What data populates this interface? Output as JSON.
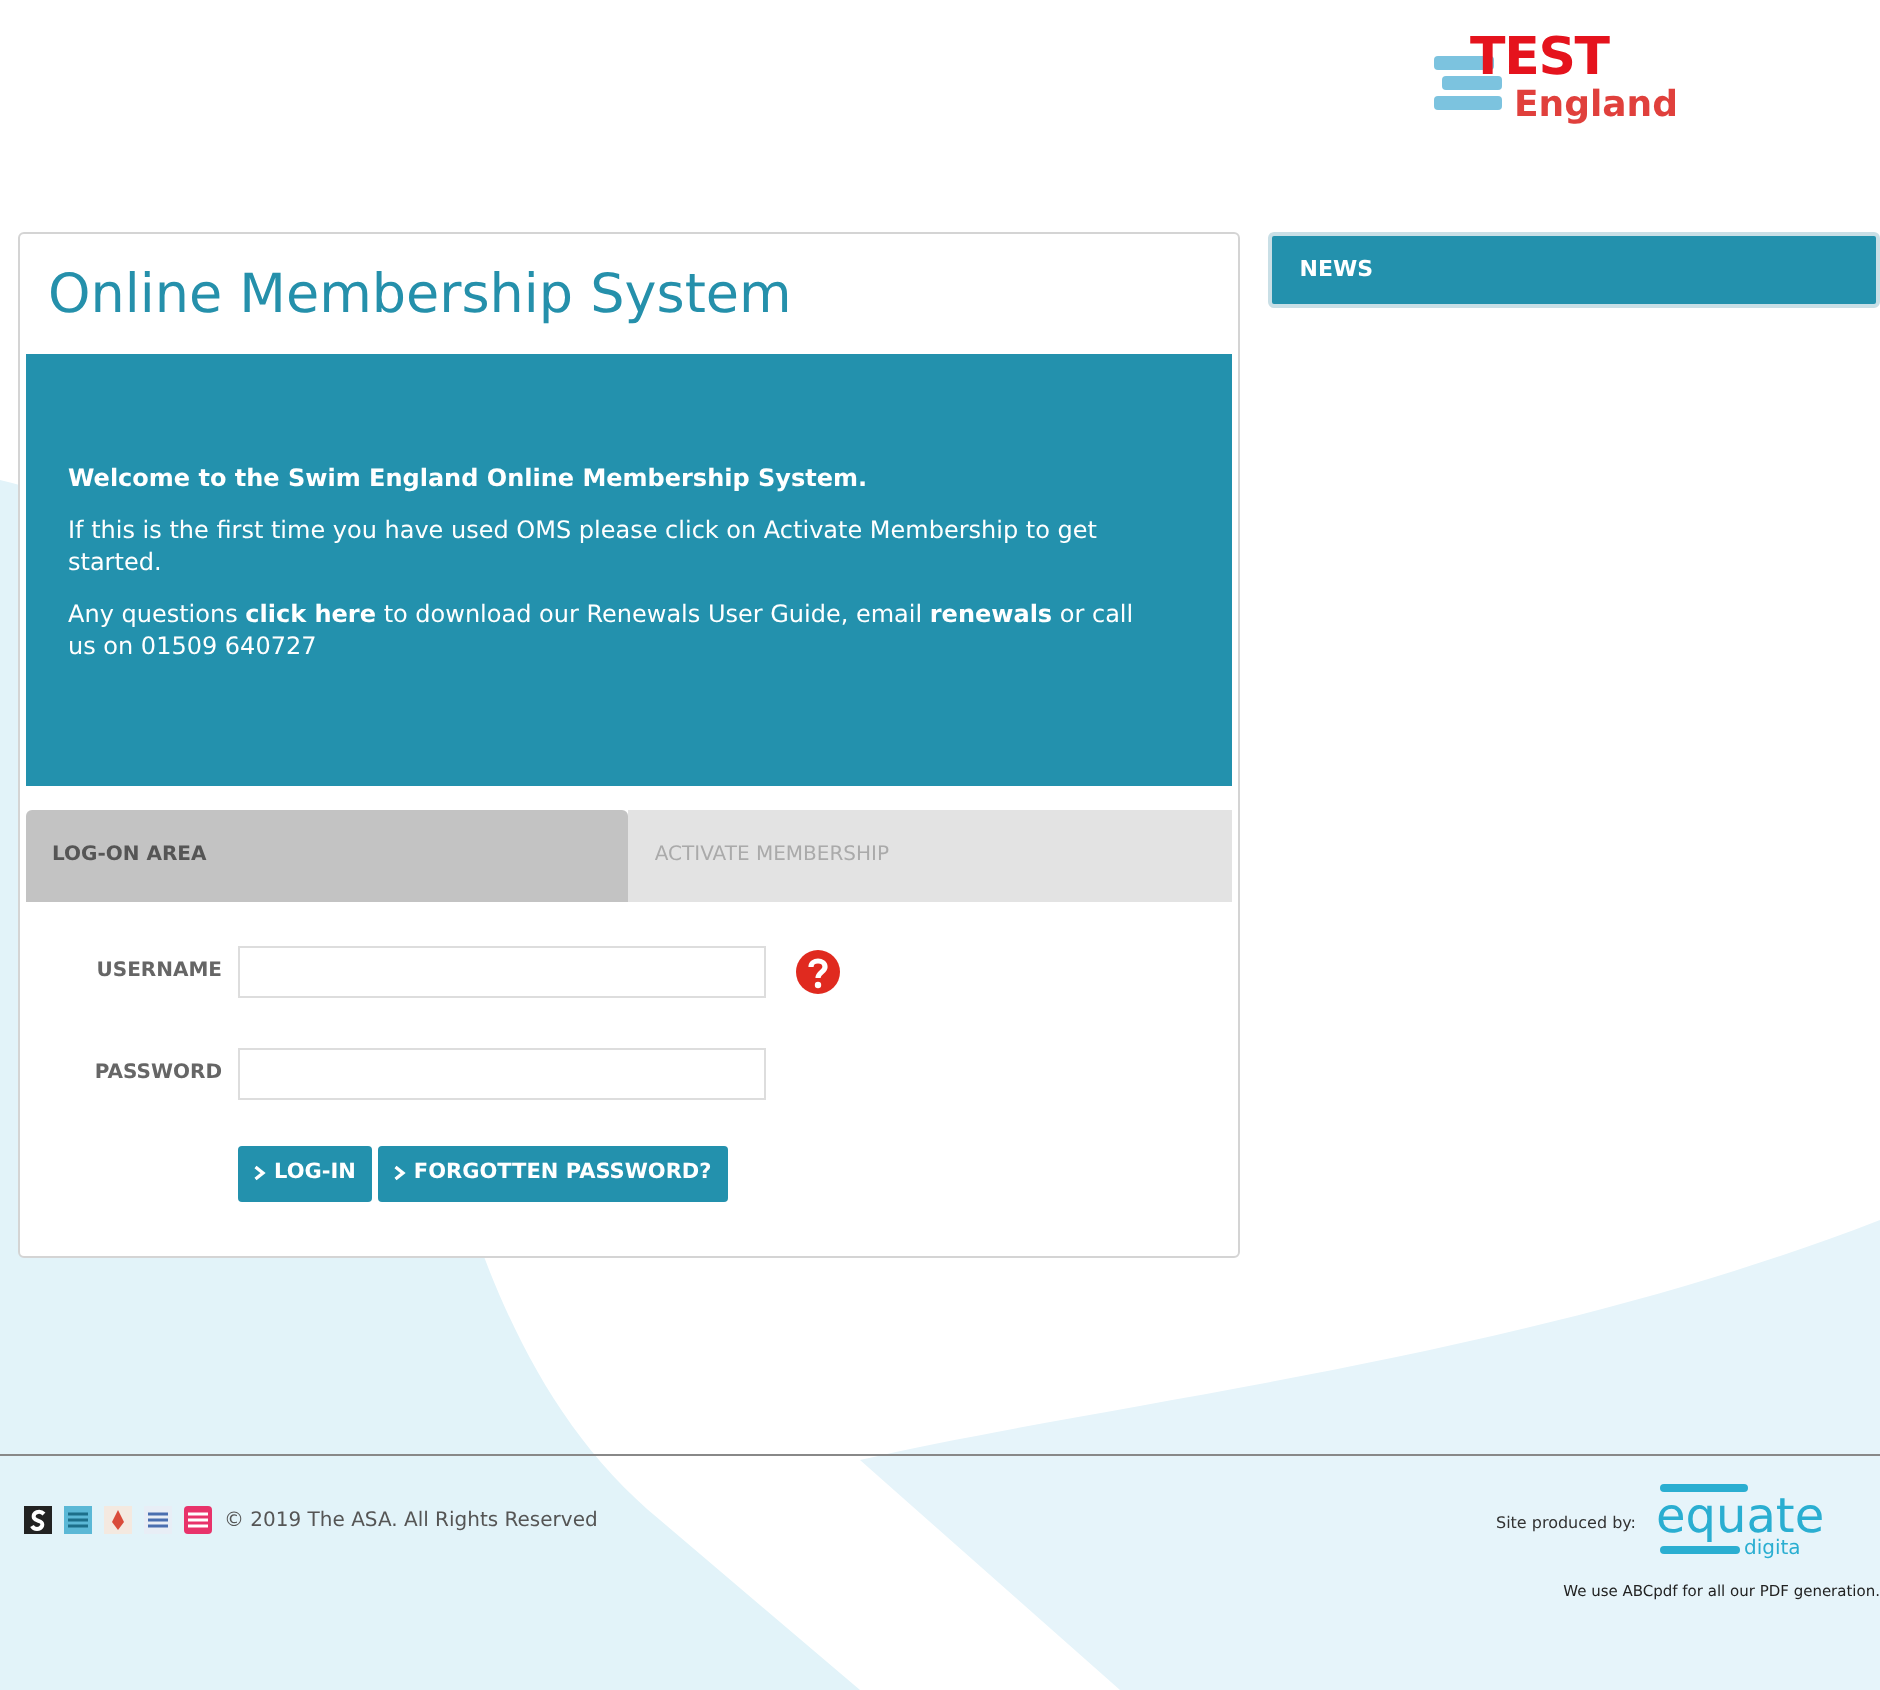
{
  "logo": {
    "overlay": "TEST",
    "line_2": "England"
  },
  "card": {
    "title": "Online Membership System",
    "intro": [
      [
        {
          "kind": "bold",
          "text": "Welcome to the Swim England Online Membership System."
        }
      ],
      [
        {
          "kind": "text",
          "text": "If this is the first time you have used OMS please click on Activate Membership to get started."
        }
      ],
      [
        {
          "kind": "text",
          "text": "Any questions "
        },
        {
          "kind": "link",
          "text": "click here"
        },
        {
          "kind": "text",
          "text": " to download our Renewals User Guide, email "
        },
        {
          "kind": "link",
          "text": "renewals"
        },
        {
          "kind": "text",
          "text": " or call us on 01509 640727"
        }
      ]
    ],
    "tabs": [
      {
        "label": "LOG-ON AREA",
        "selected": true
      },
      {
        "label": "ACTIVATE MEMBERSHIP",
        "selected": false
      }
    ],
    "fields": [
      {
        "label": "USERNAME",
        "help": true
      },
      {
        "label": "PASSWORD",
        "help": false
      }
    ],
    "buttons": [
      "LOG-IN",
      "FORGOTTEN PASSWORD?"
    ]
  },
  "news": {
    "title": "NEWS"
  },
  "footer": {
    "copyright": "© 2019 The ASA. All Rights Reserved",
    "produced_by": "Site produced by:",
    "brand": "equate",
    "brand_sub": "digita",
    "pdf_note": "We use ABCpdf for all our PDF generation."
  }
}
